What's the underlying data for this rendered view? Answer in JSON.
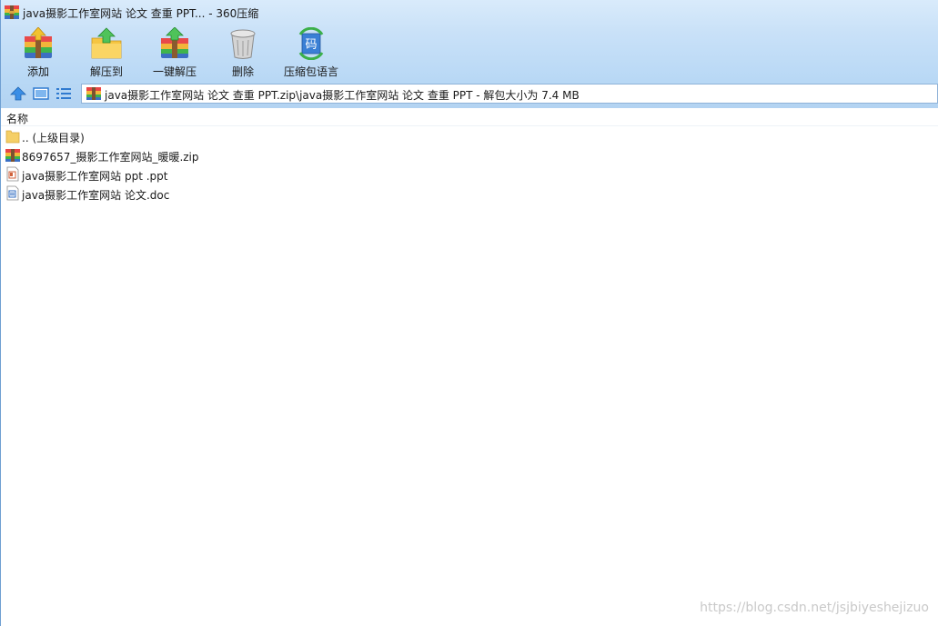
{
  "window": {
    "title": "java摄影工作室网站 论文 查重 PPT... - 360压缩"
  },
  "toolbar": {
    "buttons": [
      {
        "label": "添加",
        "icon": "add-archive-icon"
      },
      {
        "label": "解压到",
        "icon": "extract-to-icon"
      },
      {
        "label": "一键解压",
        "icon": "one-click-extract-icon"
      },
      {
        "label": "删除",
        "icon": "delete-trash-icon"
      },
      {
        "label": "压缩包语言",
        "icon": "archive-language-icon"
      }
    ],
    "language_glyph": "码"
  },
  "navigation": {
    "up_icon": "up-arrow-icon",
    "view_icon": "thumbnail-view-icon",
    "list_icon": "list-view-icon",
    "address": "java摄影工作室网站 论文 查重 PPT.zip\\java摄影工作室网站 论文 查重 PPT - 解包大小为 7.4 MB"
  },
  "file_list": {
    "column_name": "名称",
    "items": [
      {
        "name": ".. (上级目录)",
        "icon": "folder-icon"
      },
      {
        "name": "8697657_摄影工作室网站_暖暖.zip",
        "icon": "zip-archive-icon"
      },
      {
        "name": "java摄影工作室网站 ppt .ppt",
        "icon": "ppt-file-icon"
      },
      {
        "name": "java摄影工作室网站 论文.doc",
        "icon": "doc-file-icon"
      }
    ]
  },
  "watermark": "https://blog.csdn.net/jsjbiyeshejizuo",
  "colors": {
    "chrome_top": "#d9ebfb",
    "chrome_bottom": "#b3d3f2",
    "accent_blue": "#3a7fd5"
  }
}
